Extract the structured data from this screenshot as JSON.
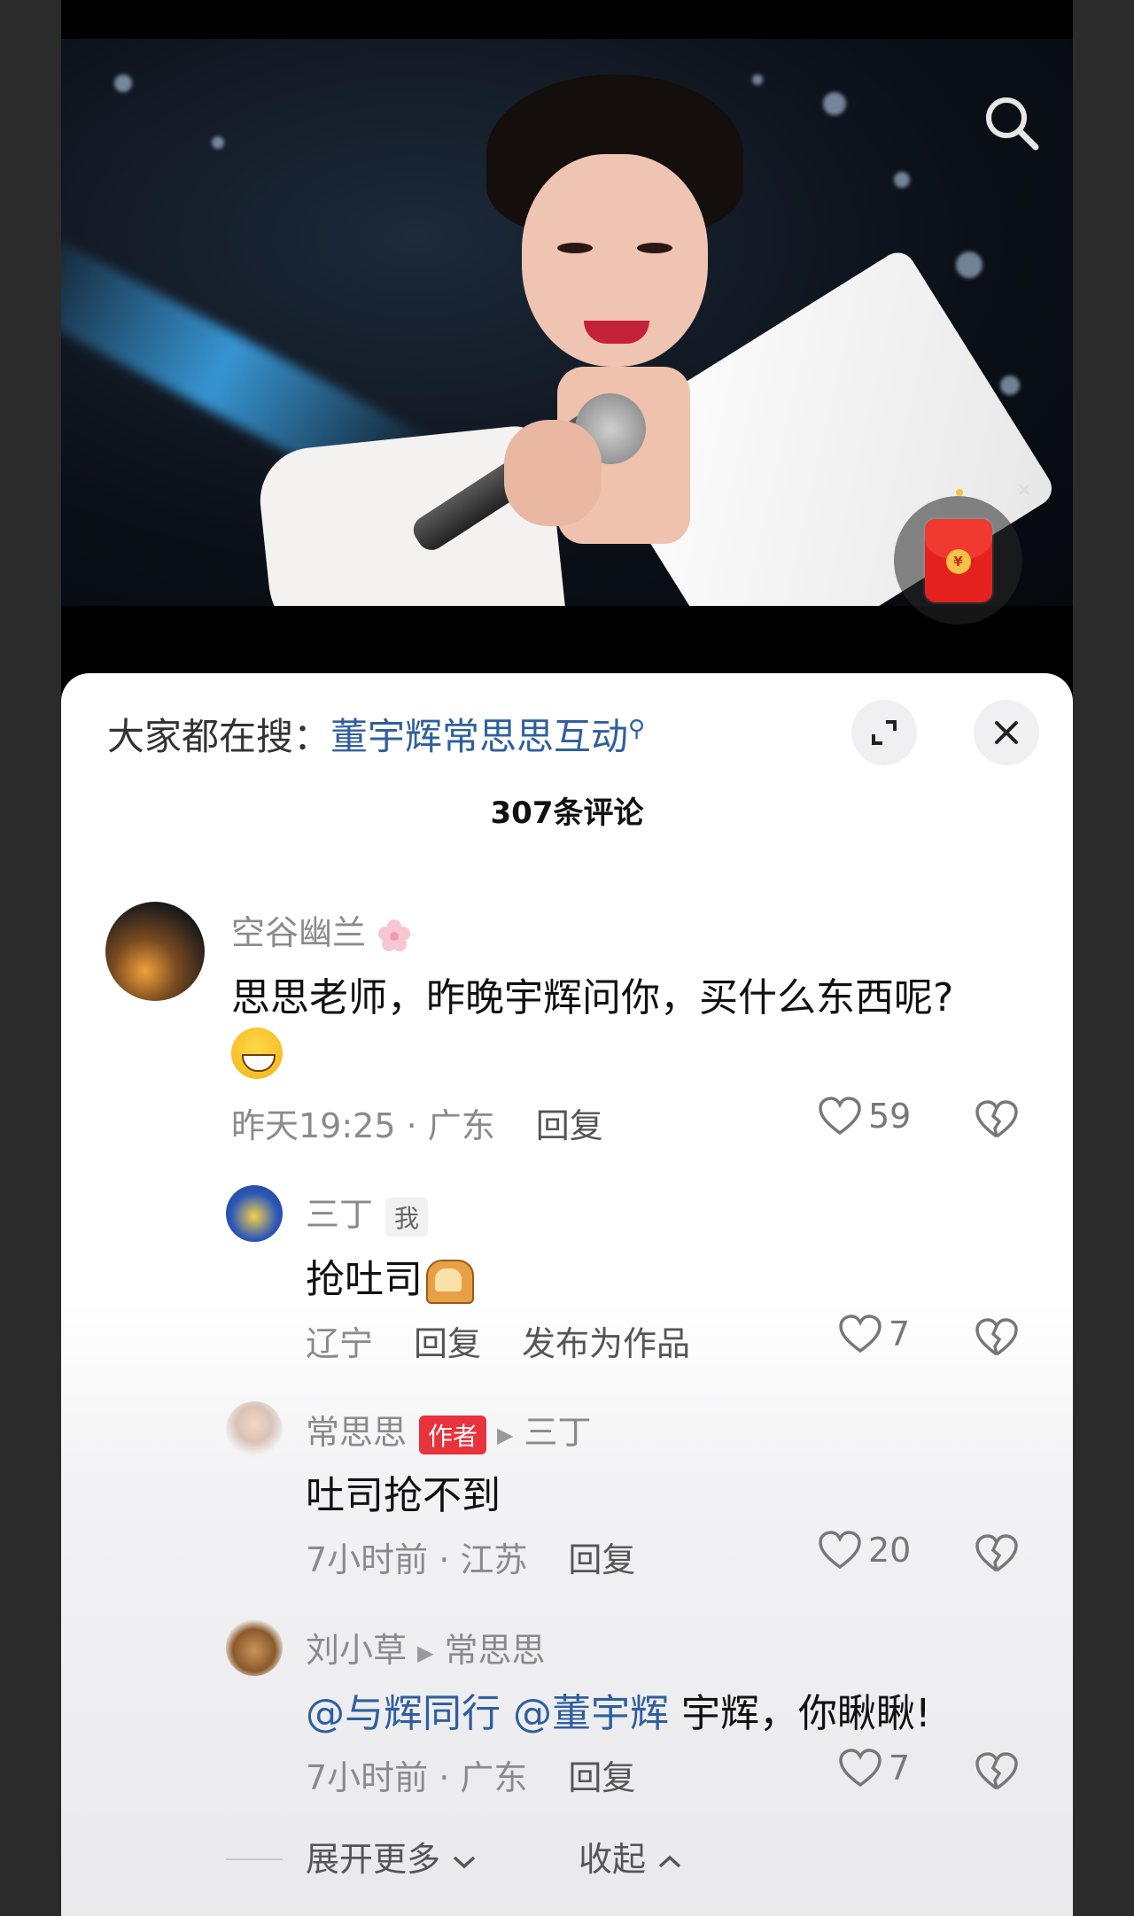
{
  "panel": {
    "search_prefix": "大家都在搜：",
    "search_keyword": "董宇辉常思思互动",
    "comment_count": "307条评论"
  },
  "icons": {
    "search": "search-icon",
    "redpacket": "red-packet-icon",
    "close_small": "close-icon",
    "expand": "expand-icon",
    "close": "close-icon",
    "like": "heart-icon",
    "dislike": "broken-heart-icon"
  },
  "comments": [
    {
      "user": "空谷幽兰",
      "text": "思思老师，昨晚宇辉问你，买什么东西呢?",
      "time": "昨天19:25 · 广东",
      "reply": "回复",
      "likes": "59"
    },
    {
      "user": "三丁",
      "tag": "我",
      "text": "抢吐司",
      "time": "辽宁",
      "reply": "回复",
      "publish": "发布为作品",
      "likes": "7"
    },
    {
      "user": "常思思",
      "tag": "作者",
      "reply_to": "三丁",
      "text": "吐司抢不到",
      "time": "7小时前 · 江苏",
      "reply": "回复",
      "likes": "20"
    },
    {
      "user": "刘小草",
      "reply_to": "常思思",
      "mention1": "@与辉同行",
      "mention2": "@董宇辉",
      "text": " 宇辉，你瞅瞅!",
      "time": "7小时前 · 广东",
      "reply": "回复",
      "likes": "7"
    }
  ],
  "footer": {
    "expand_more": "展开更多",
    "collapse": "收起"
  },
  "colors": {
    "link": "#2f5f9e",
    "author_tag": "#e8333d",
    "red_packet": "#e5211f"
  }
}
